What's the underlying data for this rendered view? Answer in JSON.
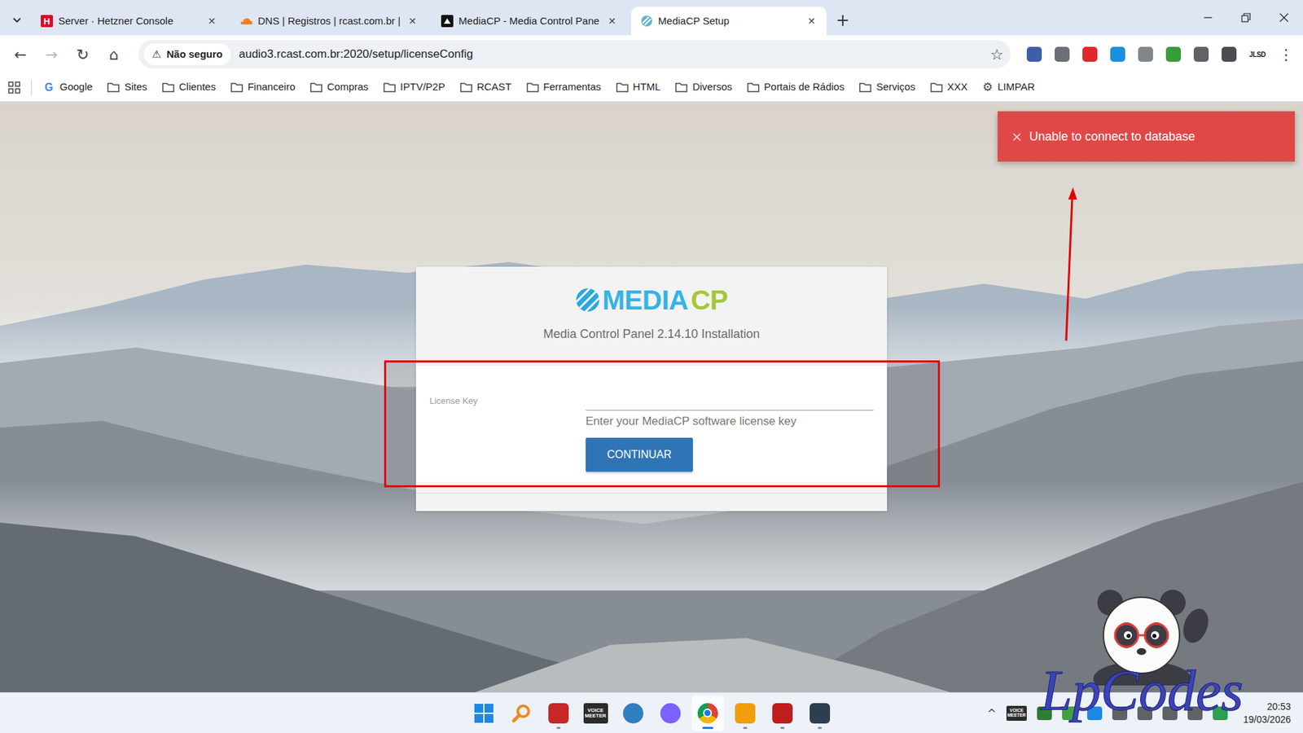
{
  "tab_close": "✕",
  "new_tab": "+",
  "tabs": [
    {
      "label": "Server · Hetzner Console",
      "kind": "hetzner",
      "icon_text": "H",
      "selected": false
    },
    {
      "label": "DNS | Registros | rcast.com.br |",
      "kind": "cloudflare",
      "selected": false
    },
    {
      "label": "MediaCP - Media Control Pane",
      "kind": "mediacp",
      "selected": false
    },
    {
      "label": "MediaCP Setup",
      "kind": "mediacp-setup",
      "selected": true
    }
  ],
  "toolbar": {
    "buttons": [
      {
        "glyph": "←",
        "disabled": false
      },
      {
        "glyph": "→",
        "disabled": true
      },
      {
        "glyph": "↻",
        "disabled": false
      },
      {
        "glyph": "⌂",
        "disabled": false
      }
    ],
    "security_glyph": "⚠",
    "security_label": "Não seguro",
    "url": "audio3.rcast.com.br:2020/setup/licenseConfig",
    "star": "☆",
    "extensions": [
      {
        "color": "#3c5fa8"
      },
      {
        "color": "#6b6f76"
      },
      {
        "color": "#e0272c"
      },
      {
        "color": "#1a8fe0"
      },
      {
        "color": "#80868b"
      },
      {
        "color": "#3a9b3a"
      },
      {
        "color": "#5f6368"
      },
      {
        "color": "#4a4d52"
      }
    ],
    "profile": "JLSD",
    "menu": "⋮"
  },
  "bookmarks": [
    {
      "label": "Google",
      "kind": "google",
      "icon_text": "G"
    },
    {
      "label": "Sites",
      "kind": "folder"
    },
    {
      "label": "Clientes",
      "kind": "folder"
    },
    {
      "label": "Financeiro",
      "kind": "folder"
    },
    {
      "label": "Compras",
      "kind": "folder"
    },
    {
      "label": "IPTV/P2P",
      "kind": "folder"
    },
    {
      "label": "RCAST",
      "kind": "folder"
    },
    {
      "label": "Ferramentas",
      "kind": "folder"
    },
    {
      "label": "HTML",
      "kind": "folder"
    },
    {
      "label": "Diversos",
      "kind": "folder"
    },
    {
      "label": "Portais de Rádios",
      "kind": "folder"
    },
    {
      "label": "Serviços",
      "kind": "folder"
    },
    {
      "label": "XXX",
      "kind": "folder"
    },
    {
      "label": "LIMPAR",
      "kind": "gear",
      "icon": "⚙"
    }
  ],
  "page": {
    "logo": {
      "part_a": "MEDIA",
      "part_b": "CP"
    },
    "subtitle": "Media Control Panel 2.14.10 Installation",
    "form": {
      "label": "License Key",
      "hint": "Enter your MediaCP software license key",
      "button": "CONTINUAR"
    }
  },
  "toast": {
    "icon": "×",
    "message": "Unable to connect to database"
  },
  "watermark": {
    "text": "LpCodes"
  },
  "taskbar": {
    "apps": [
      {
        "kind": "windows",
        "color": "#1e88e5",
        "running": false,
        "selected": false
      },
      {
        "kind": "search",
        "color": "#f08a1c",
        "running": false,
        "selected": false
      },
      {
        "kind": "square",
        "color": "#c62828",
        "running": true,
        "selected": false
      },
      {
        "kind": "voicemeeter",
        "color": "#2b2b2b",
        "label": "VOICE MEETER",
        "running": false,
        "selected": false
      },
      {
        "kind": "circle",
        "color": "#2f7fc1",
        "running": false,
        "selected": false
      },
      {
        "kind": "circle",
        "color": "#7b61ff",
        "running": false,
        "selected": false
      },
      {
        "kind": "chrome",
        "color": "#1a73e8",
        "running": true,
        "selected": true
      },
      {
        "kind": "square",
        "color": "#f29d0c",
        "running": true,
        "selected": false
      },
      {
        "kind": "square",
        "color": "#bf1e1e",
        "running": true,
        "selected": false
      },
      {
        "kind": "square",
        "color": "#2c3e50",
        "running": true,
        "selected": false
      }
    ],
    "tray_toggle": "^",
    "tray": [
      {
        "kind": "voicemeeter",
        "color": "#2b2b2b",
        "label": "VOICE MEETER"
      },
      {
        "kind": "square",
        "color": "#2e7d32"
      },
      {
        "kind": "square",
        "color": "#43a047"
      },
      {
        "kind": "square",
        "color": "#1e88e5"
      },
      {
        "kind": "square",
        "color": "#5f6368"
      },
      {
        "kind": "square",
        "color": "#5f6368"
      },
      {
        "kind": "square",
        "color": "#5f6368"
      },
      {
        "kind": "square",
        "color": "#5f6368"
      },
      {
        "kind": "square",
        "color": "#2e9e4f"
      }
    ],
    "clock": {
      "time": "20:53",
      "date": "19/03/2026"
    }
  }
}
